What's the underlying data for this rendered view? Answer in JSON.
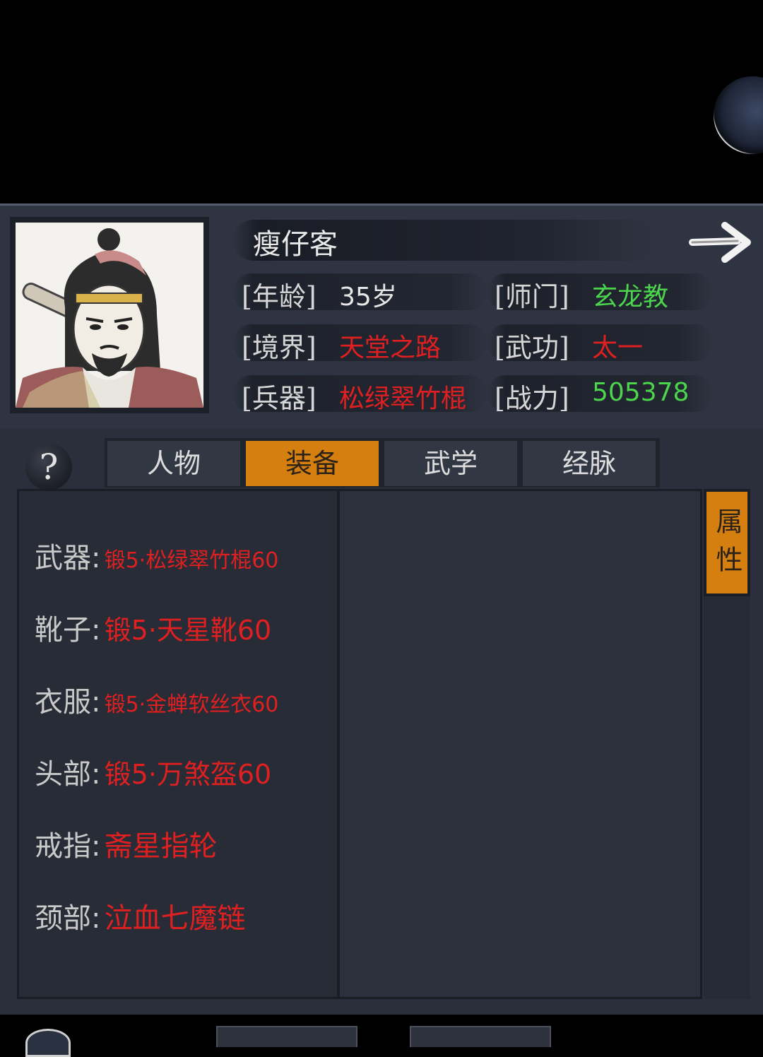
{
  "hero": {
    "name": "瘦仔客"
  },
  "stats": {
    "age_label": "[年龄]",
    "age_value": "35岁",
    "sect_label": "[师门]",
    "sect_value": "玄龙教",
    "realm_label": "[境界]",
    "realm_value": "天堂之路",
    "martial_label": "[武功]",
    "martial_value": "太一",
    "weapon_label": "[兵器]",
    "weapon_value": "松绿翠竹棍",
    "power_label": "[战力]",
    "power_value": "505378"
  },
  "tabs": [
    {
      "label": "人物",
      "active": false
    },
    {
      "label": "装备",
      "active": true
    },
    {
      "label": "武学",
      "active": false
    },
    {
      "label": "经脉",
      "active": false
    }
  ],
  "help_label": "?",
  "side_tab_label": "属性",
  "equipment": [
    {
      "slot": "武器:",
      "item": "锻5·松绿翠竹棍60"
    },
    {
      "slot": "靴子:",
      "item": "锻5·天星靴60"
    },
    {
      "slot": "衣服:",
      "item": "锻5·金蝉软丝衣60"
    },
    {
      "slot": "头部:",
      "item": "锻5·万煞盔60"
    },
    {
      "slot": "戒指:",
      "item": "斋星指轮"
    },
    {
      "slot": "颈部:",
      "item": "泣血七魔链"
    }
  ],
  "colors": {
    "accent_orange": "#d67f11",
    "item_red": "#e02020",
    "value_green": "#4cd44c",
    "panel_bg": "#2f3442"
  },
  "icons": {
    "next": "right-arrow-icon",
    "help": "question-icon"
  }
}
